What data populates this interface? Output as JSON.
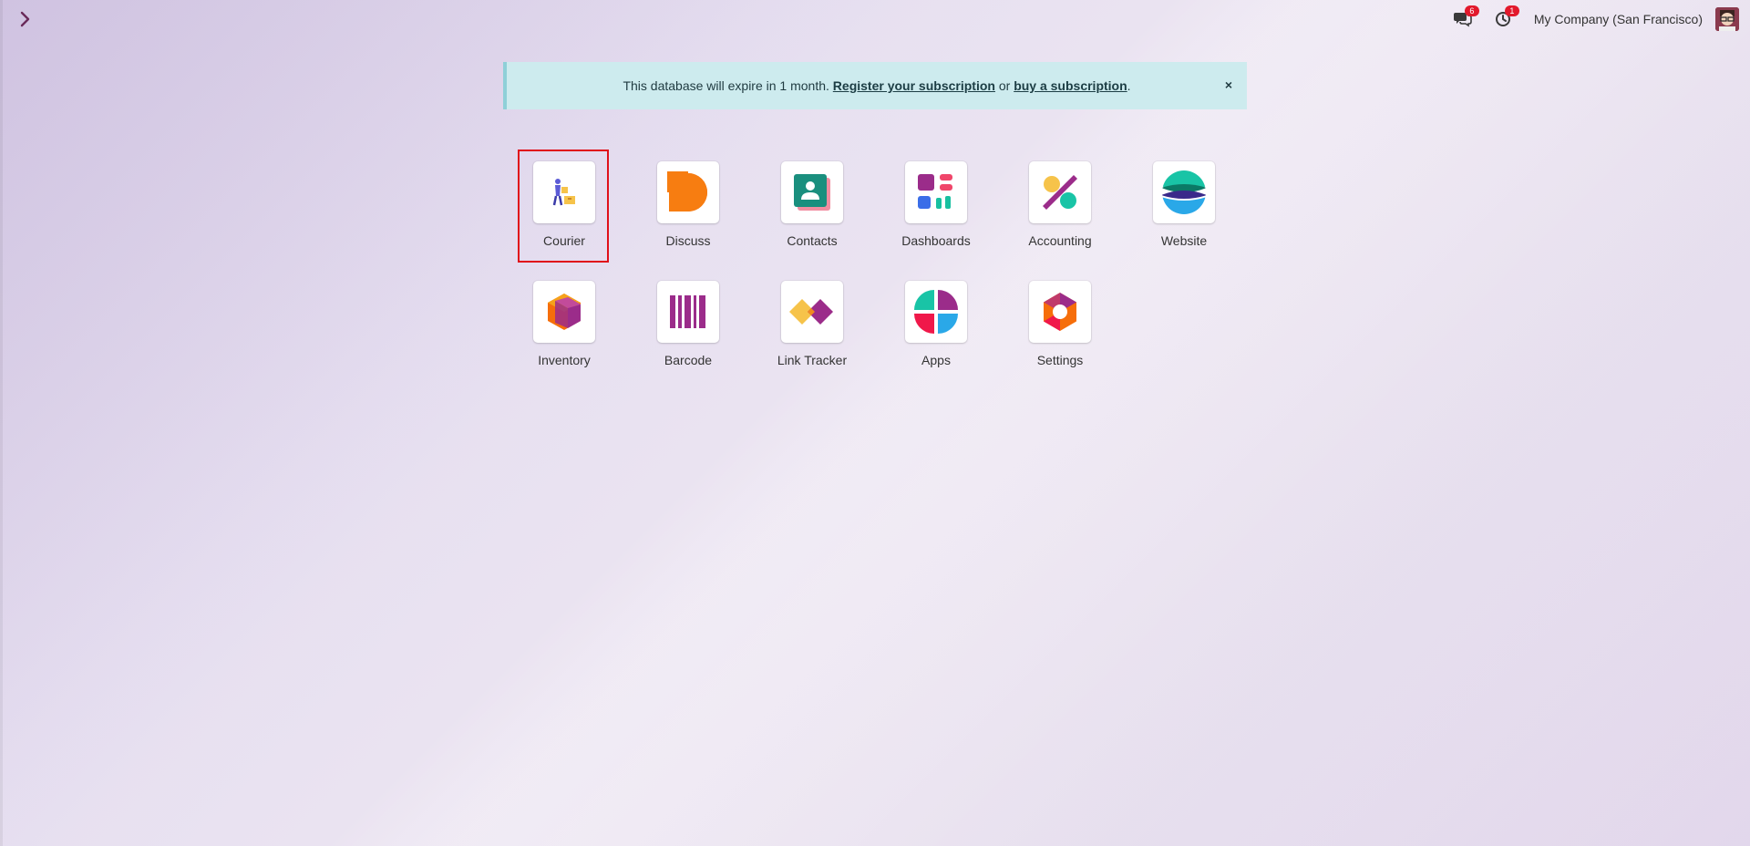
{
  "top_bar": {
    "menu_toggle_icon": "chevron-right-icon",
    "chat_icon": "chat-icon",
    "chat_badge": "6",
    "activity_icon": "clock-icon",
    "activity_badge": "1",
    "company": "My Company (San Francisco)",
    "avatar_icon": "user-avatar"
  },
  "alert": {
    "text_before": "This database will expire in 1 month.",
    "register_link": "Register your subscription",
    "text_middle": "or",
    "buy_link": "buy a subscription",
    "text_after": ".",
    "close_label": "×"
  },
  "apps": [
    {
      "label": "Courier",
      "icon": "courier-icon"
    },
    {
      "label": "Discuss",
      "icon": "discuss-icon"
    },
    {
      "label": "Contacts",
      "icon": "contacts-icon"
    },
    {
      "label": "Dashboards",
      "icon": "dashboards-icon"
    },
    {
      "label": "Accounting",
      "icon": "accounting-icon"
    },
    {
      "label": "Website",
      "icon": "website-icon"
    },
    {
      "label": "Inventory",
      "icon": "inventory-icon"
    },
    {
      "label": "Barcode",
      "icon": "barcode-icon"
    },
    {
      "label": "Link Tracker",
      "icon": "link-tracker-icon"
    },
    {
      "label": "Apps",
      "icon": "apps-icon"
    },
    {
      "label": "Settings",
      "icon": "settings-icon"
    }
  ],
  "selected_app": "Courier",
  "colors": {
    "alert_bg": "#cdebee",
    "badge": "#e2192c",
    "highlight": "#e0101a"
  }
}
